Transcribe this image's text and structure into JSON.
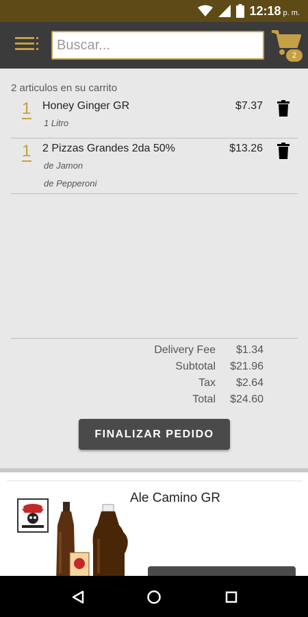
{
  "status_bar": {
    "time": "12:18",
    "ampm": "p. m."
  },
  "search": {
    "placeholder": "Buscar..."
  },
  "cart_icon": {
    "badge_count": "2"
  },
  "cart": {
    "count_text": "2 articulos en su carrito",
    "items": [
      {
        "qty": "1",
        "name": "Honey Ginger GR",
        "options": [
          "1 Litro"
        ],
        "price": "$7.37"
      },
      {
        "qty": "1",
        "name": "2 Pizzas Grandes 2da 50%",
        "options": [
          "de Jamon",
          "de Pepperoni"
        ],
        "price": "$13.26"
      }
    ],
    "totals": [
      {
        "label": "Delivery Fee",
        "value": "$1.34"
      },
      {
        "label": "Subtotal",
        "value": "$21.96"
      },
      {
        "label": "Tax",
        "value": "$2.64"
      },
      {
        "label": "Total",
        "value": "$24.60"
      }
    ],
    "checkout_label": "FINALIZAR PEDIDO"
  },
  "product": {
    "name": "Ale Camino GR"
  },
  "colors": {
    "status_bar": "#5e4a17",
    "app_bar": "#3b3b3b",
    "accent_gold": "#c5a044",
    "button_dark": "#4a4a4a"
  },
  "icons": {
    "menu": "menu-icon",
    "cart": "cart-icon",
    "delete": "trash-icon",
    "nav_back": "back-triangle-icon",
    "nav_home": "home-circle-icon",
    "nav_recents": "recents-square-icon"
  }
}
